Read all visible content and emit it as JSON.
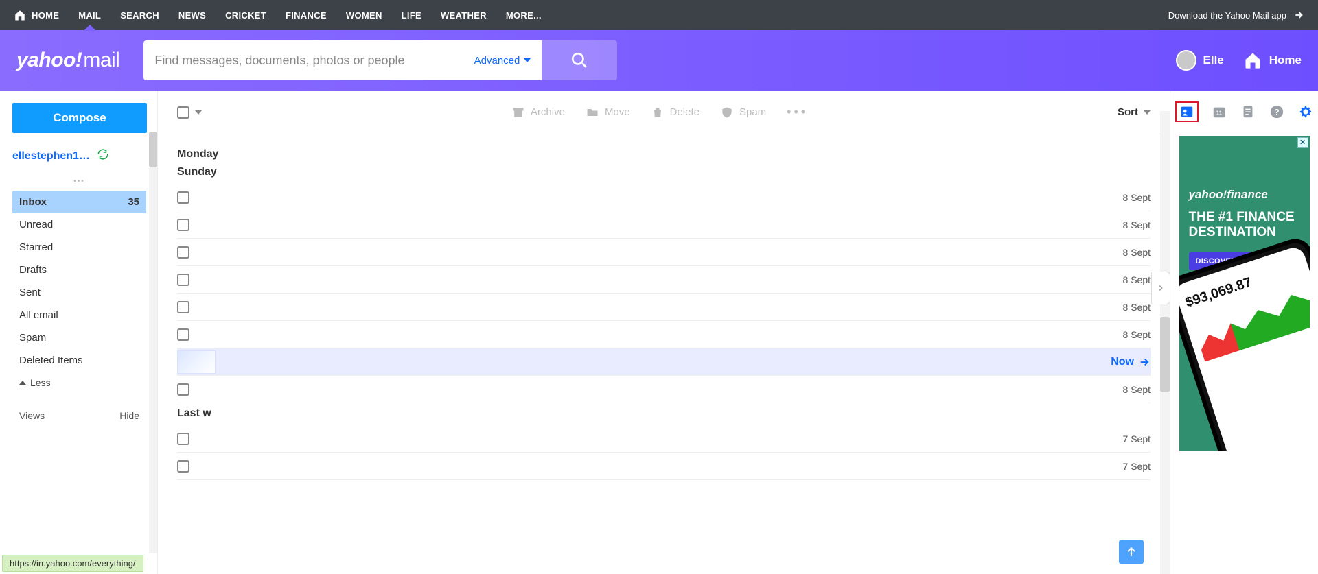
{
  "topbar": {
    "items": [
      {
        "label": "HOME",
        "has_icon": true,
        "active": false
      },
      {
        "label": "MAIL",
        "active": true
      },
      {
        "label": "SEARCH"
      },
      {
        "label": "NEWS"
      },
      {
        "label": "CRICKET"
      },
      {
        "label": "FINANCE"
      },
      {
        "label": "WOMEN"
      },
      {
        "label": "LIFE"
      },
      {
        "label": "WEATHER"
      },
      {
        "label": "MORE..."
      }
    ],
    "promo": "Download the Yahoo Mail app"
  },
  "header": {
    "logo_main": "yahoo!",
    "logo_sub": "mail",
    "search_placeholder": "Find messages, documents, photos or people",
    "advanced": "Advanced",
    "user_name": "Elle",
    "home_label": "Home"
  },
  "sidebar": {
    "compose": "Compose",
    "account": "ellestephen1…",
    "folders": [
      {
        "label": "Inbox",
        "count": "35",
        "active": true
      },
      {
        "label": "Unread"
      },
      {
        "label": "Starred"
      },
      {
        "label": "Drafts"
      },
      {
        "label": "Sent"
      },
      {
        "label": "All email"
      },
      {
        "label": "Spam"
      },
      {
        "label": "Deleted Items"
      }
    ],
    "less": "Less",
    "views": "Views",
    "hide": "Hide"
  },
  "toolbar": {
    "archive": "Archive",
    "move": "Move",
    "delete": "Delete",
    "spam": "Spam",
    "sort": "Sort"
  },
  "list": {
    "groups": [
      {
        "label": "Monday",
        "rows": []
      },
      {
        "label": "Sunday",
        "rows": [
          {
            "date": "8 Sept"
          },
          {
            "date": "8 Sept"
          },
          {
            "date": "8 Sept"
          },
          {
            "date": "8 Sept"
          },
          {
            "date": "8 Sept"
          },
          {
            "date": "8 Sept"
          },
          {
            "now": "Now",
            "thumb": true
          },
          {
            "date": "8 Sept"
          }
        ]
      },
      {
        "label": "Last w",
        "rows": [
          {
            "date": "7 Sept"
          },
          {
            "date": "7 Sept"
          }
        ]
      }
    ]
  },
  "ad": {
    "logo": "yahoo!finance",
    "headline": "THE #1 FINANCE DESTINATION",
    "cta": "DISCOVER WHAT'S NEW",
    "phone_big": "$93,069.87"
  },
  "status_url": "https://in.yahoo.com/everything/"
}
